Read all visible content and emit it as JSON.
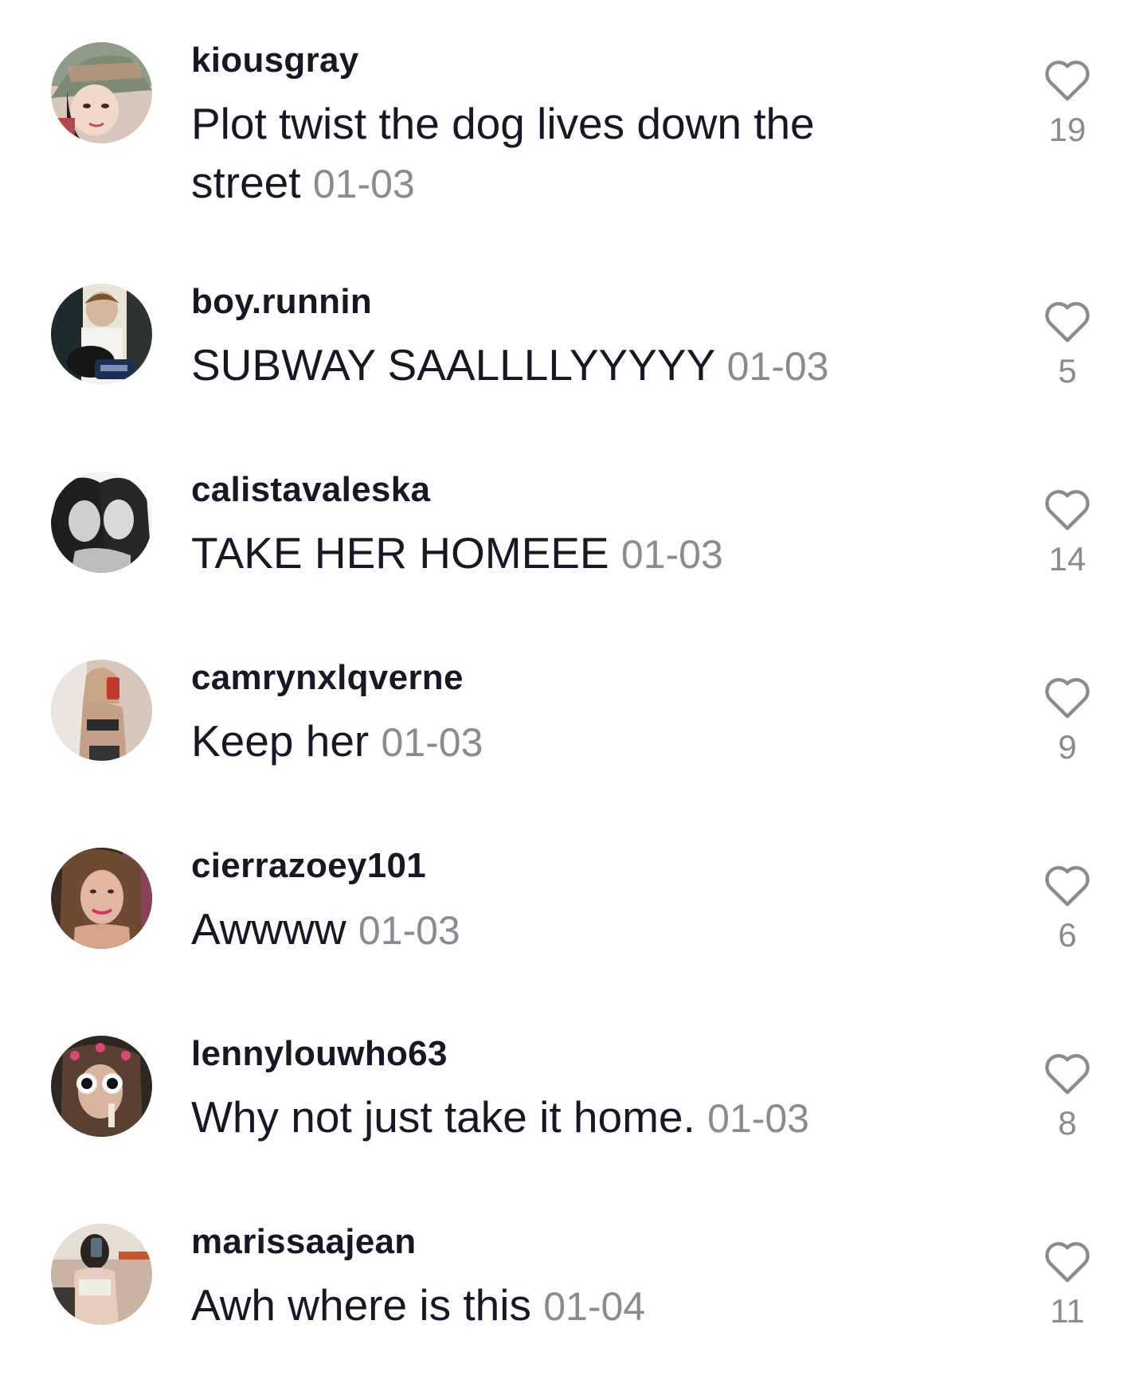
{
  "comments": [
    {
      "username": "kiousgray",
      "text": "Plot twist the dog lives down the street",
      "date": "01-03",
      "likes": "19",
      "avatar": "avatar-hat-girl"
    },
    {
      "username": "boy.runnin",
      "text": "SUBWAY SAALLLLYYYYY",
      "date": "01-03",
      "likes": "5",
      "avatar": "avatar-boy-with-dog"
    },
    {
      "username": "calistavaleska",
      "text": "TAKE HER HOMEEE",
      "date": "01-03",
      "likes": "14",
      "avatar": "avatar-two-girls-bw"
    },
    {
      "username": "camrynxlqverne",
      "text": "Keep her",
      "date": "01-03",
      "likes": "9",
      "avatar": "avatar-mirror-selfie"
    },
    {
      "username": "cierrazoey101",
      "text": "Awwww",
      "date": "01-03",
      "likes": "6",
      "avatar": "avatar-girl-smiling"
    },
    {
      "username": "lennylouwho63",
      "text": "Why not just take it home.",
      "date": "01-03",
      "likes": "8",
      "avatar": "avatar-white-sunglasses"
    },
    {
      "username": "marissaajean",
      "text": "Awh where is this",
      "date": "01-04",
      "likes": "11",
      "avatar": "avatar-mirror-selfie-2"
    }
  ],
  "icons": {
    "like": "heart-outline-icon"
  },
  "colors": {
    "text": "#161823",
    "muted": "#8a8b91",
    "background": "#ffffff"
  }
}
